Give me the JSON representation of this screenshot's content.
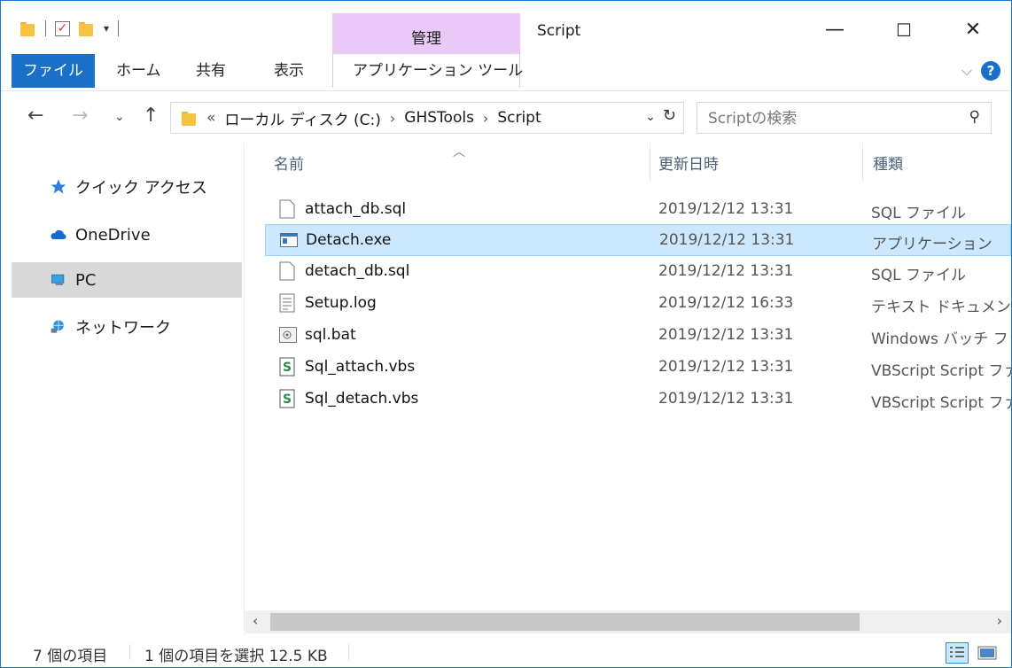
{
  "window": {
    "title": "Script",
    "context_tab_header": "管理",
    "buttons": {
      "minimize": "—",
      "maximize": "☐",
      "close": "✕"
    }
  },
  "ribbon": {
    "tabs": [
      {
        "label": "ファイル"
      },
      {
        "label": "ホーム"
      },
      {
        "label": "共有"
      },
      {
        "label": "表示"
      },
      {
        "label": "アプリケーション ツール"
      }
    ]
  },
  "address": {
    "prefix": "«",
    "crumbs": [
      "ローカル ディスク (C:)",
      "GHSTools",
      "Script"
    ],
    "search_placeholder": "Scriptの検索"
  },
  "navpane": {
    "items": [
      {
        "label": "クイック アクセス",
        "icon": "star-icon"
      },
      {
        "label": "OneDrive",
        "icon": "cloud-icon"
      },
      {
        "label": "PC",
        "icon": "pc-icon",
        "selected": true
      },
      {
        "label": "ネットワーク",
        "icon": "network-icon"
      }
    ]
  },
  "columns": {
    "name": "名前",
    "date": "更新日時",
    "type": "種類"
  },
  "files": [
    {
      "name": "attach_db.sql",
      "date": "2019/12/12 13:31",
      "type": "SQL ファイル",
      "icon": "file-icon"
    },
    {
      "name": "Detach.exe",
      "date": "2019/12/12 13:31",
      "type": "アプリケーション",
      "icon": "exe-icon",
      "selected": true
    },
    {
      "name": "detach_db.sql",
      "date": "2019/12/12 13:31",
      "type": "SQL ファイル",
      "icon": "file-icon"
    },
    {
      "name": "Setup.log",
      "date": "2019/12/12 16:33",
      "type": "テキスト ドキュメント",
      "icon": "text-file-icon"
    },
    {
      "name": "sql.bat",
      "date": "2019/12/12 13:31",
      "type": "Windows バッチ ファイル",
      "icon": "batch-file-icon"
    },
    {
      "name": "Sql_attach.vbs",
      "date": "2019/12/12 13:31",
      "type": "VBScript Script ファイル",
      "icon": "vbs-file-icon"
    },
    {
      "name": "Sql_detach.vbs",
      "date": "2019/12/12 13:31",
      "type": "VBScript Script ファイル",
      "icon": "vbs-file-icon"
    }
  ],
  "status": {
    "item_count": "7 個の項目",
    "selection": "1 個の項目を選択  12.5 KB"
  },
  "colors": {
    "accent": "#1a6fc9",
    "selection_bg": "#cce8ff",
    "context_tab": "#eac8f7"
  }
}
